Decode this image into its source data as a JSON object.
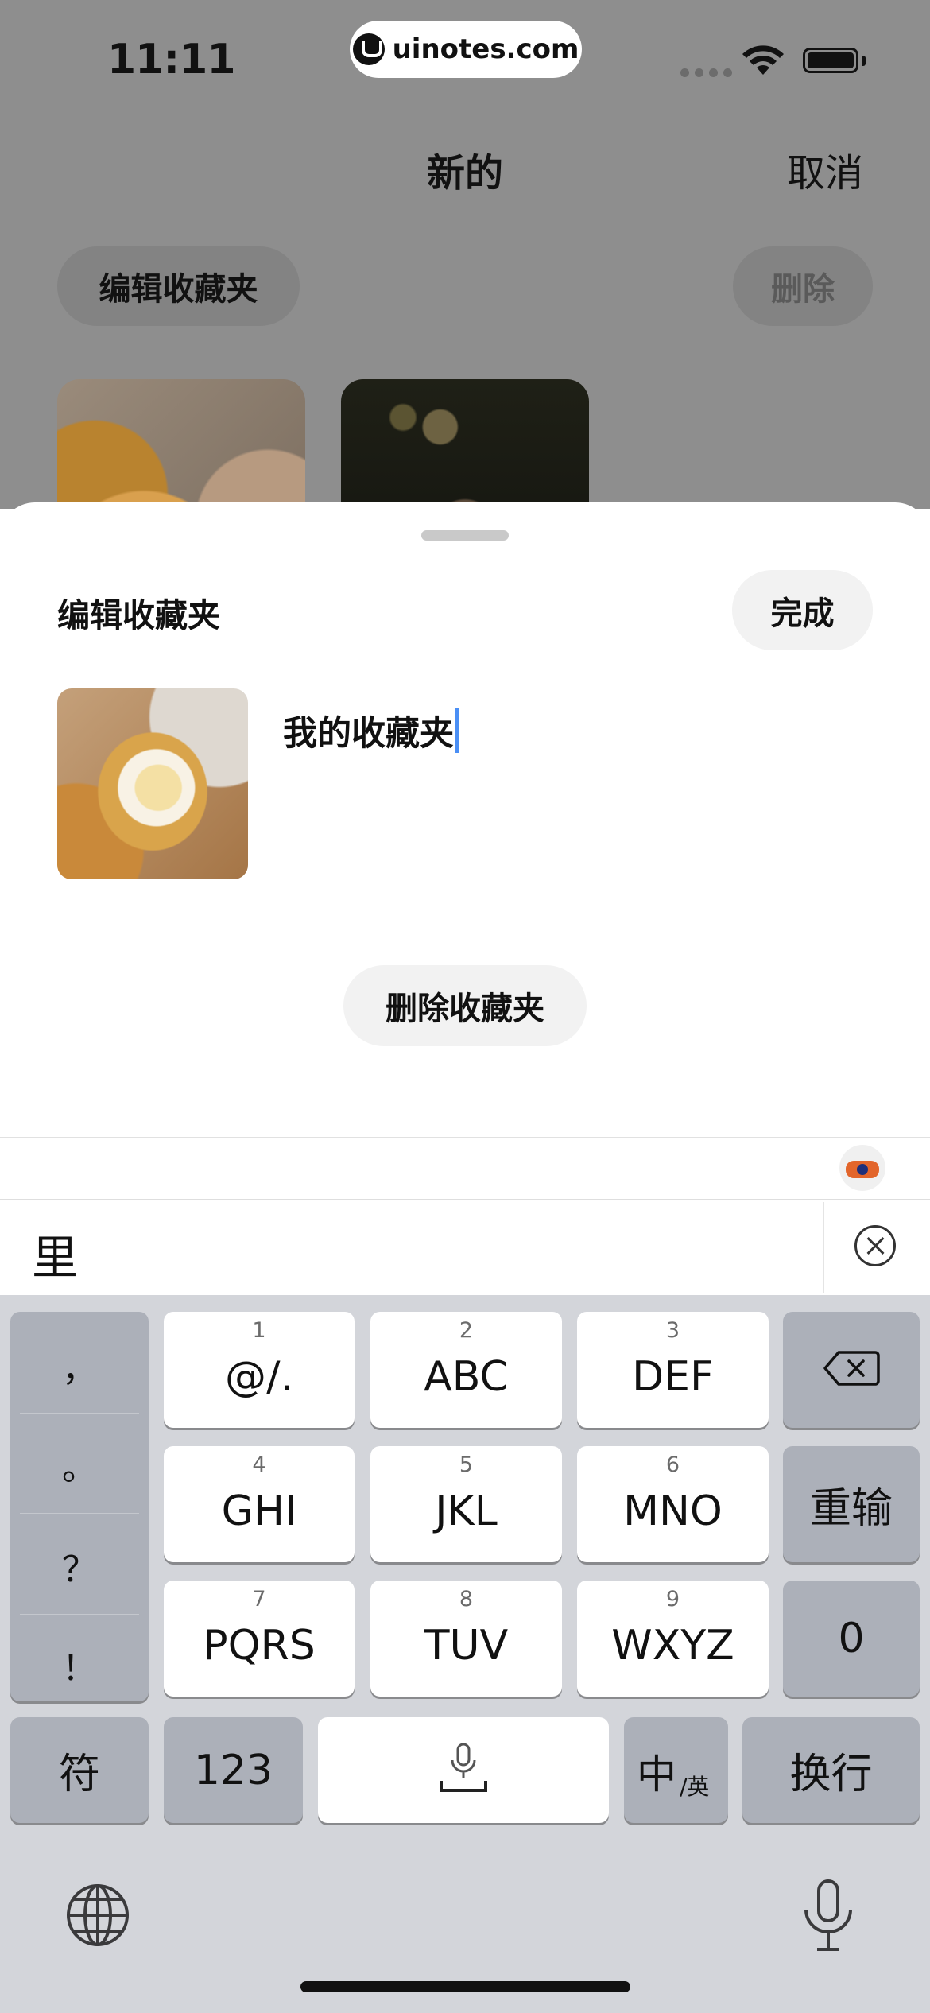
{
  "status_bar": {
    "time": "11:11",
    "url": "uinotes.com"
  },
  "background_page": {
    "title": "新的",
    "cancel_label": "取消",
    "edit_folder_label": "编辑收藏夹",
    "delete_label": "删除"
  },
  "sheet": {
    "title": "编辑收藏夹",
    "done_label": "完成",
    "name_value": "我的收藏夹",
    "delete_folder_label": "删除收藏夹"
  },
  "keyboard": {
    "candidate": "里",
    "punctuation": [
      "，",
      "。",
      "？",
      "！"
    ],
    "keys": [
      {
        "num": "1",
        "label": "@/."
      },
      {
        "num": "2",
        "label": "ABC"
      },
      {
        "num": "3",
        "label": "DEF"
      },
      {
        "num": "4",
        "label": "GHI"
      },
      {
        "num": "5",
        "label": "JKL"
      },
      {
        "num": "6",
        "label": "MNO"
      },
      {
        "num": "7",
        "label": "PQRS"
      },
      {
        "num": "8",
        "label": "TUV"
      },
      {
        "num": "9",
        "label": "WXYZ"
      }
    ],
    "reenter_label": "重输",
    "zero_label": "0",
    "symbol_label": "符",
    "numbers_label": "123",
    "lang_main": "中",
    "lang_sub": "/英",
    "return_label": "换行"
  },
  "icons": {
    "wifi": "wifi-icon",
    "battery": "battery-icon",
    "backspace": "backspace-icon",
    "globe": "globe-icon",
    "mic": "microphone-icon",
    "close": "close-circle-icon"
  },
  "colors": {
    "caret": "#4a8ff5",
    "keyboard_bg": "#d3d5da",
    "dim_overlay": "#8e8e8e"
  }
}
